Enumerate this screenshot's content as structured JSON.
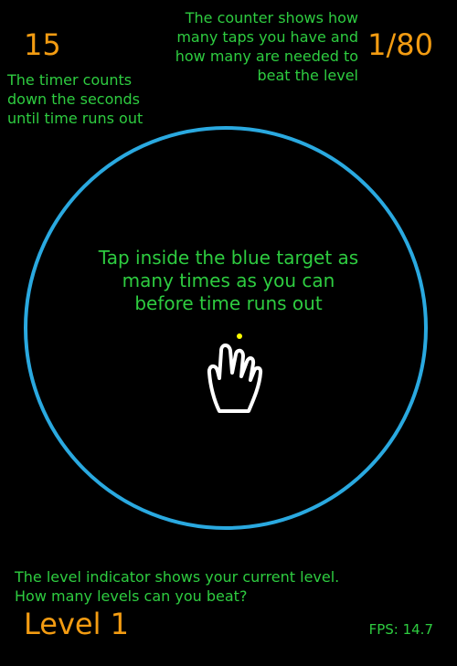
{
  "timer": {
    "value": "15",
    "hint": "The timer counts\ndown the seconds\nuntil time runs out"
  },
  "counter": {
    "value": "1/80",
    "hint": "The counter shows how\nmany taps you have and\nhow many are needed to\nbeat the level"
  },
  "target": {
    "hint": "Tap inside the blue target as\nmany times as you can\nbefore time runs out",
    "icon": "tap-hand-icon"
  },
  "level": {
    "hint": "The level indicator shows your current level.\nHow many levels can you beat?",
    "label": "Level 1"
  },
  "fps": {
    "label": "FPS: 14.7"
  },
  "colors": {
    "background": "#000000",
    "accent_orange": "#f39c12",
    "hint_green": "#2ecc40",
    "target_blue": "#2aa9e0",
    "tap_dot_yellow": "#ffff00"
  }
}
